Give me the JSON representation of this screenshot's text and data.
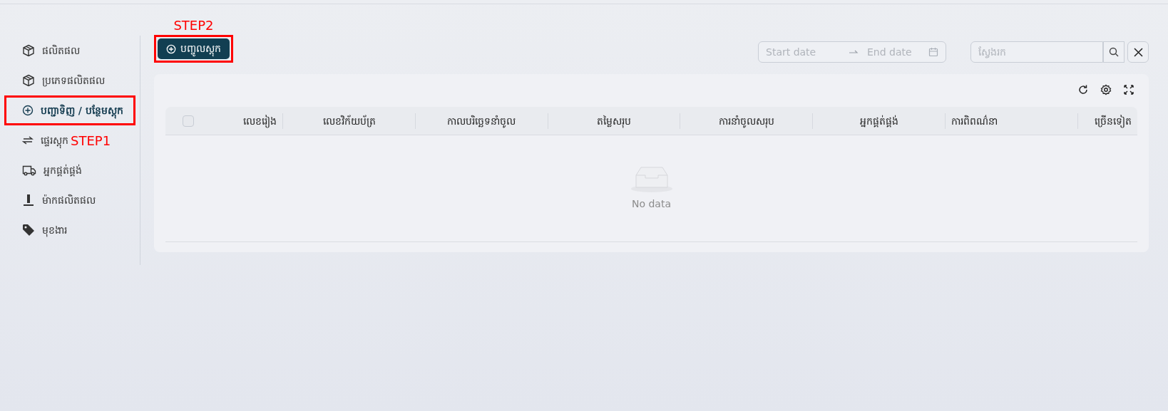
{
  "sidebar": {
    "items": [
      {
        "label": "ផលិតផល",
        "selected": false
      },
      {
        "label": "ប្រភេទផលិតផល",
        "selected": false
      },
      {
        "label": "បញ្ជាទិញ / បន្ថែមស្តុក",
        "selected": true,
        "annotation_box": true
      },
      {
        "label": "ផ្ទេរស្តុក",
        "selected": false,
        "annotation": "STEP1"
      },
      {
        "label": "អ្នកផ្គត់ផ្គង់",
        "selected": false
      },
      {
        "label": "ម៉ាកផលិតផល",
        "selected": false
      },
      {
        "label": "មុខងារ",
        "selected": false
      }
    ]
  },
  "toolbar": {
    "add_button": {
      "label": "បញ្ចូលស្តុក",
      "annotation": "STEP2"
    },
    "date_range": {
      "start_placeholder": "Start date",
      "end_placeholder": "End date"
    },
    "search": {
      "placeholder": "ស្វែងរក"
    }
  },
  "table": {
    "columns": [
      "លេខរៀង",
      "លេខវិក័យប័ត្រ",
      "កាលបរិច្ឆេទនាំចូល",
      "តម្លៃសរុប",
      "ការនាំចូលសរុប",
      "អ្នកផ្គត់ផ្គង់",
      "ការពិពណ៌នា",
      "ច្រើនទៀត"
    ],
    "select_all_checked": false,
    "empty_text": "No data"
  }
}
